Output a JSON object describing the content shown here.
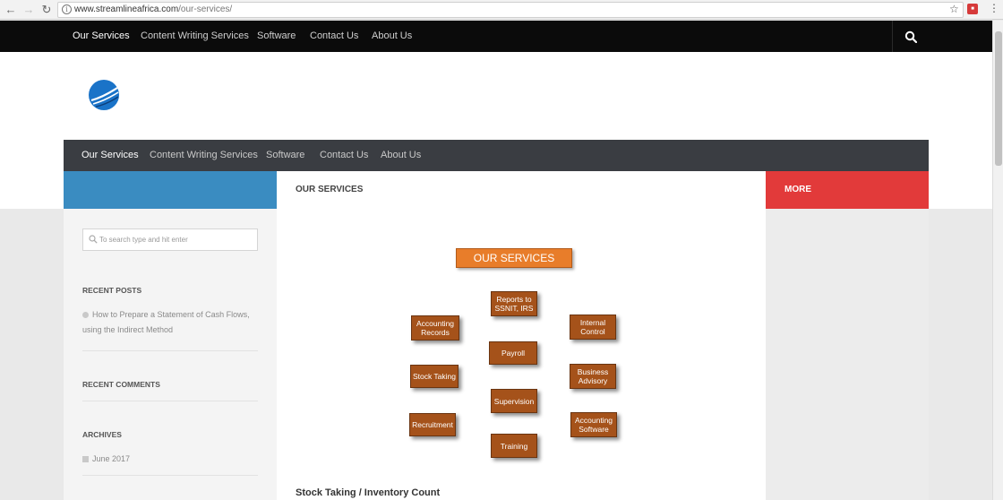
{
  "browser": {
    "url_host": "www.streamlineafrica.com",
    "url_path": "/our-services/"
  },
  "topnav": {
    "items": [
      "Our Services",
      "Content Writing Services",
      "Software",
      "Contact Us",
      "About Us"
    ]
  },
  "mainnav": {
    "items": [
      "Our Services",
      "Content Writing Services",
      "Software",
      "Contact Us",
      "About Us"
    ]
  },
  "sidebar": {
    "search_placeholder": "To search type and hit enter",
    "recent_posts_title": "RECENT POSTS",
    "recent_post_line1": "How to Prepare a Statement of Cash Flows,",
    "recent_post_line2": "using the Indirect Method",
    "recent_comments_title": "RECENT COMMENTS",
    "archives_title": "ARCHIVES",
    "archive_item": "June 2017"
  },
  "content": {
    "title": "OUR SERVICES",
    "subheading": "Stock Taking / Inventory Count"
  },
  "right": {
    "more_label": "MORE"
  },
  "diagram": {
    "title": "OUR SERVICES",
    "boxes": {
      "reports": "Reports to SSNIT, IRS",
      "accounting_records": "Accounting Records",
      "internal_control": "Internal Control",
      "payroll": "Payroll",
      "stock_taking": "Stock Taking",
      "business_advisory": "Business Advisory",
      "supervision": "Supervision",
      "recruitment": "Recruitment",
      "accounting_software": "Accounting Software",
      "training": "Training"
    }
  },
  "colors": {
    "topnav_bg": "#0b0b0b",
    "mainnav_bg": "#3a3d42",
    "blue_accent": "#3a8cc1",
    "red_accent": "#e23a3a",
    "diagram_title": "#e87d2a",
    "diagram_box": "#a5521a"
  }
}
